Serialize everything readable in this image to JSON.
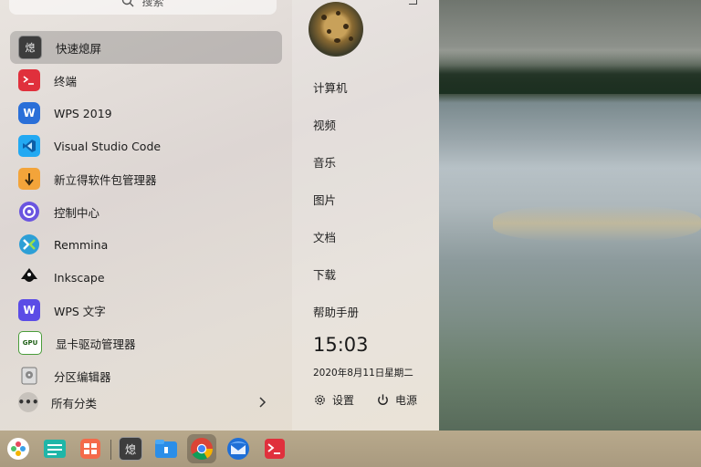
{
  "search": {
    "placeholder": "搜索"
  },
  "apps": [
    {
      "label": "快速熄屏",
      "icon": "screen-off-icon",
      "selected": true
    },
    {
      "label": "终端",
      "icon": "terminal-icon"
    },
    {
      "label": "WPS 2019",
      "icon": "wps-icon"
    },
    {
      "label": "Visual Studio Code",
      "icon": "vscode-icon"
    },
    {
      "label": "新立得软件包管理器",
      "icon": "synaptic-icon"
    },
    {
      "label": "控制中心",
      "icon": "control-center-icon"
    },
    {
      "label": "Remmina",
      "icon": "remmina-icon"
    },
    {
      "label": "Inkscape",
      "icon": "inkscape-icon"
    },
    {
      "label": "WPS 文字",
      "icon": "wps-writer-icon"
    },
    {
      "label": "显卡驱动管理器",
      "icon": "gpu-driver-icon"
    },
    {
      "label": "分区编辑器",
      "icon": "partition-editor-icon"
    }
  ],
  "all_categories": {
    "label": "所有分类"
  },
  "places": [
    "计算机",
    "视频",
    "音乐",
    "图片",
    "文档",
    "下载",
    "帮助手册"
  ],
  "clock": {
    "time": "15:03",
    "date": "2020年8月11日星期二"
  },
  "settings_label": "设置",
  "power_label": "电源",
  "taskbar": [
    {
      "icon": "launcher-icon"
    },
    {
      "icon": "multitask-view-icon"
    },
    {
      "icon": "app-store-icon"
    },
    {
      "icon": "screen-off-icon"
    },
    {
      "icon": "file-manager-icon"
    },
    {
      "icon": "chrome-icon",
      "active": true
    },
    {
      "icon": "thunderbird-icon"
    },
    {
      "icon": "terminal-icon"
    }
  ],
  "colors": {
    "accent": "#1e7ad6",
    "selected_bg": "#8a8a8a"
  }
}
